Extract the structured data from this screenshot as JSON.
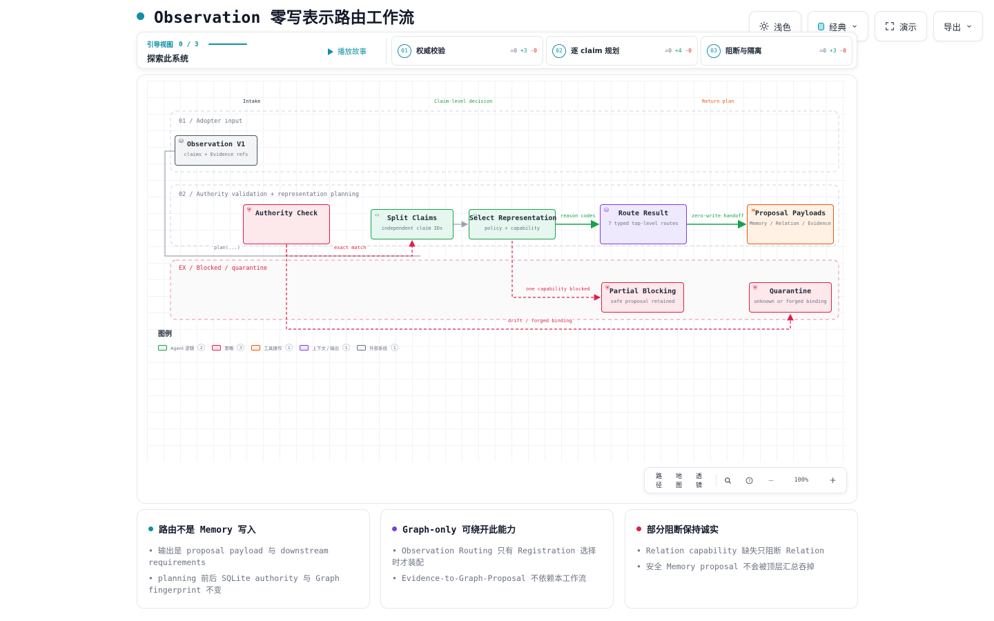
{
  "title": "Observation 零写表示路由工作流",
  "controls": {
    "theme_label": "浅色",
    "style_label": "经典",
    "present_label": "演示",
    "export_label": "导出"
  },
  "guide": {
    "label": "引导视图",
    "count": "0 / 3",
    "subtitle": "探索此系统",
    "play_label": "播放故事",
    "steps": [
      {
        "num": "01",
        "name": "权威校验",
        "eq": "=0",
        "plus": "+3",
        "minus": "-0"
      },
      {
        "num": "02",
        "name": "逐 claim 规划",
        "eq": "=0",
        "plus": "+4",
        "minus": "-0"
      },
      {
        "num": "03",
        "name": "阻断与隔离",
        "eq": "=0",
        "plus": "+3",
        "minus": "-0"
      }
    ]
  },
  "diagram": {
    "columns": [
      {
        "label": "Intake",
        "color": "#4b5563"
      },
      {
        "label": "Claim-level decision",
        "color": "#16a34a"
      },
      {
        "label": "Return plan",
        "color": "#ea580c"
      }
    ],
    "lanes": [
      {
        "label": "01 / Adopter input",
        "color": "#9ca3af"
      },
      {
        "label": "02 / Authority validation + representation planning",
        "color": "#9ca3af"
      },
      {
        "label": "EX / Blocked / quarantine",
        "color": "#e11d48"
      }
    ],
    "nodes": {
      "observation": {
        "title": "Observation V1",
        "sub": "claims + Evidence refs"
      },
      "authority": {
        "title": "Authority Check",
        "sub": ""
      },
      "split": {
        "title": "Split Claims",
        "sub": "independent claim IDs"
      },
      "select": {
        "title": "Select Representation",
        "sub": "policy + capability"
      },
      "route": {
        "title": "Route Result",
        "sub": "7 typed top-level routes"
      },
      "proposal": {
        "title": "Proposal Payloads",
        "sub": "Memory / Relation / Evidence"
      },
      "partial": {
        "title": "Partial Blocking",
        "sub": "safe proposal retained"
      },
      "quarantine": {
        "title": "Quarantine",
        "sub": "unknown or forged binding"
      }
    },
    "edge_labels": {
      "plan": "plan(...)",
      "exact_match": "exact match",
      "reason_codes": "reason codes",
      "zero_write": "zero-write handoff",
      "one_capability": "one capability blocked",
      "drift": "drift / forged binding"
    },
    "legend": {
      "title": "图例",
      "items": [
        {
          "label": "Agent 逻辑",
          "count": "2",
          "color": "#16a34a",
          "fill": "#e6f7ef"
        },
        {
          "label": "策略",
          "count": "3",
          "color": "#e11d48",
          "fill": "#fde8ec"
        },
        {
          "label": "工具操作",
          "count": "1",
          "color": "#ea580c",
          "fill": "#fff1e3"
        },
        {
          "label": "上下文 / 输出",
          "count": "1",
          "color": "#7c3aed",
          "fill": "#efe9fd"
        },
        {
          "label": "外部系统",
          "count": "1",
          "color": "#6b7280",
          "fill": "#f3f4f6"
        }
      ]
    }
  },
  "zoom_bar": {
    "path_label": "路径",
    "map_label": "地图",
    "lens_label": "透镜",
    "zoom": "100%",
    "minus": "−",
    "plus": "+"
  },
  "cards": [
    {
      "title": "路由不是 Memory 写入",
      "color": "#0e8fa6",
      "items": [
        "• 输出是 proposal payload 与 downstream requirements",
        "• planning 前后 SQLite authority 与 Graph fingerprint 不变"
      ]
    },
    {
      "title": "Graph-only 可绕开此能力",
      "color": "#7c3aed",
      "items": [
        "• Observation Routing 只有 Registration 选择时才装配",
        "• Evidence-to-Graph-Proposal 不依赖本工作流"
      ]
    },
    {
      "title": "部分阻断保持诚实",
      "color": "#e11d48",
      "items": [
        "• Relation capability 缺失只阻断 Relation",
        "• 安全 Memory proposal 不会被顶层汇总吞掉"
      ]
    }
  ]
}
